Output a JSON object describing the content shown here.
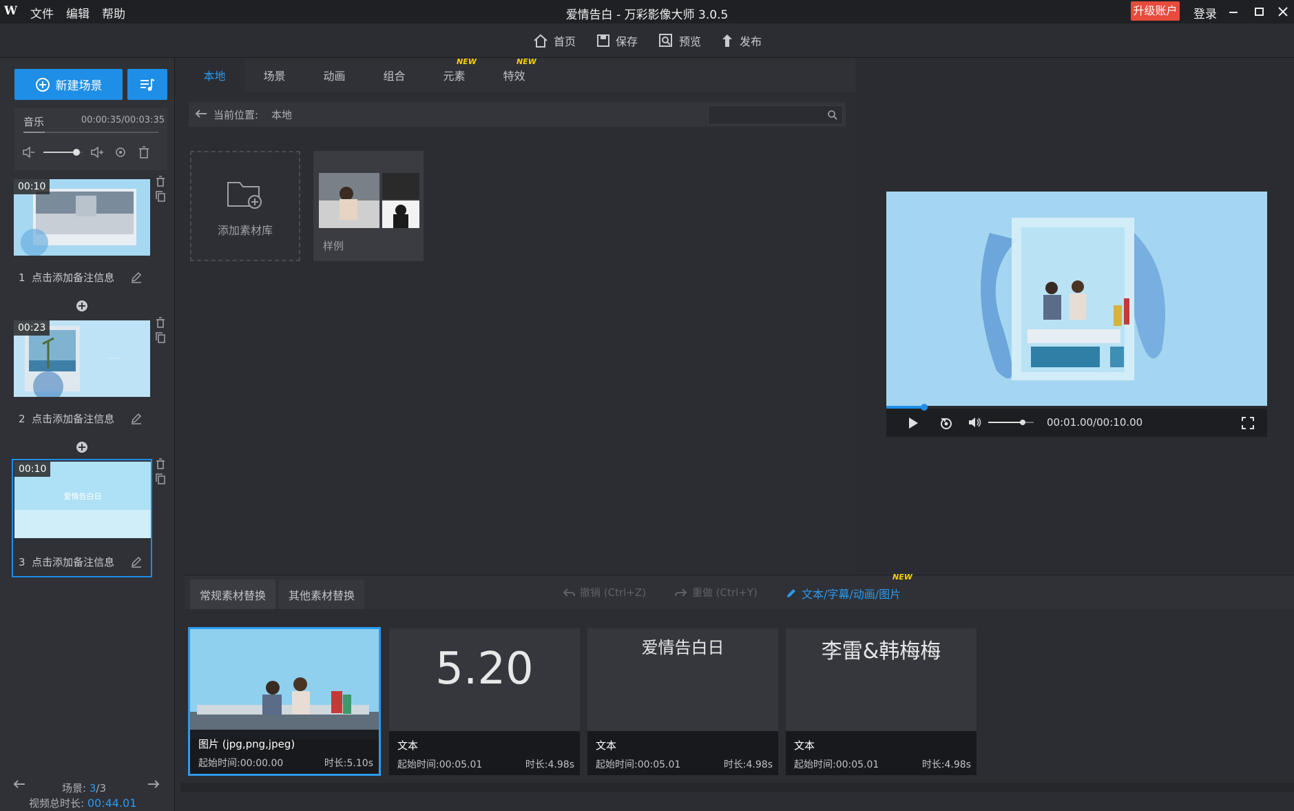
{
  "app": {
    "logo_text": "W",
    "title": "爱情告白 - 万彩影像大师 3.0.5",
    "menu": [
      "文件",
      "编辑",
      "帮助"
    ],
    "upgrade_label": "升级账户",
    "login_label": "登录"
  },
  "toolbar": {
    "home": "首页",
    "save": "保存",
    "preview": "预览",
    "publish": "发布"
  },
  "left": {
    "new_scene_label": "新建场景",
    "music": {
      "label": "音乐",
      "time": "00:00:35/00:03:35",
      "volume_fraction": 0.85,
      "progress_fraction": 0.16
    },
    "scenes": [
      {
        "index": "1",
        "duration": "00:10",
        "note": "点击添加备注信息"
      },
      {
        "index": "2",
        "duration": "00:23",
        "note": "点击添加备注信息"
      },
      {
        "index": "3",
        "duration": "00:10",
        "note": "点击添加备注信息",
        "title_text": "爱情告白日"
      }
    ],
    "footer": {
      "scene_label": "场景:",
      "scene_current": "3",
      "scene_total": "/3",
      "total_label": "视频总时长:",
      "total_value": "00:44.01"
    }
  },
  "library": {
    "tabs": [
      {
        "label": "本地",
        "active": true
      },
      {
        "label": "场景"
      },
      {
        "label": "动画"
      },
      {
        "label": "组合"
      },
      {
        "label": "元素",
        "badge": "NEW"
      },
      {
        "label": "特效",
        "badge": "NEW"
      }
    ],
    "path_label": "当前位置:",
    "path_value": "本地",
    "search_placeholder": "",
    "add_lib_label": "添加素材库",
    "sample_label": "样例"
  },
  "player": {
    "time": "00:01.00/00:10.00",
    "progress_fraction": 0.1,
    "volume_fraction": 0.75
  },
  "bottom": {
    "tabs": [
      "常规素材替换",
      "其他素材替换"
    ],
    "undo": "撤销 (Ctrl+Z)",
    "redo": "重做 (Ctrl+Y)",
    "edit_link": "文本/字幕/动画/图片",
    "edit_badge": "NEW",
    "clips": [
      {
        "kind": "图片 (jpg,png,jpeg)",
        "start": "起始时间:00:00.00",
        "length": "时长:5.10s"
      },
      {
        "kind": "文本",
        "start": "起始时间:00:05.01",
        "length": "时长:4.98s",
        "text": "5.20"
      },
      {
        "kind": "文本",
        "start": "起始时间:00:05.01",
        "length": "时长:4.98s",
        "text": "爱情告白日"
      },
      {
        "kind": "文本",
        "start": "起始时间:00:05.01",
        "length": "时长:4.98s",
        "text": "李雷&韩梅梅"
      }
    ]
  },
  "colors": {
    "accent": "#1e8ee6",
    "upgrade": "#e84a3c",
    "badge": "#f5d100"
  }
}
